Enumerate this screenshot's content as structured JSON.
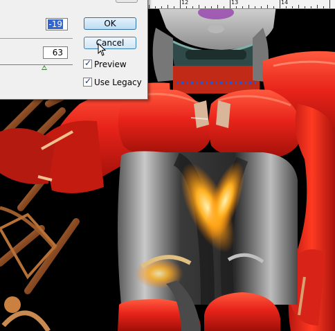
{
  "dialog": {
    "field_top_value": "-19",
    "field_bottom_value": "63",
    "ok_label": "OK",
    "cancel_label": "Cancel",
    "preview_label": "Preview",
    "preview_checked": true,
    "legacy_label": "Use Legacy",
    "legacy_checked": true,
    "slider_level": 0.63
  },
  "ruler": {
    "labels": [
      "12",
      "13",
      "14"
    ]
  },
  "icons": {
    "cursor": "arrow-cursor-icon",
    "check": "checkmark-icon"
  },
  "colors": {
    "armor_red": "#e8231a",
    "button_border": "#3c7fb1",
    "selection": "#3366cc"
  }
}
